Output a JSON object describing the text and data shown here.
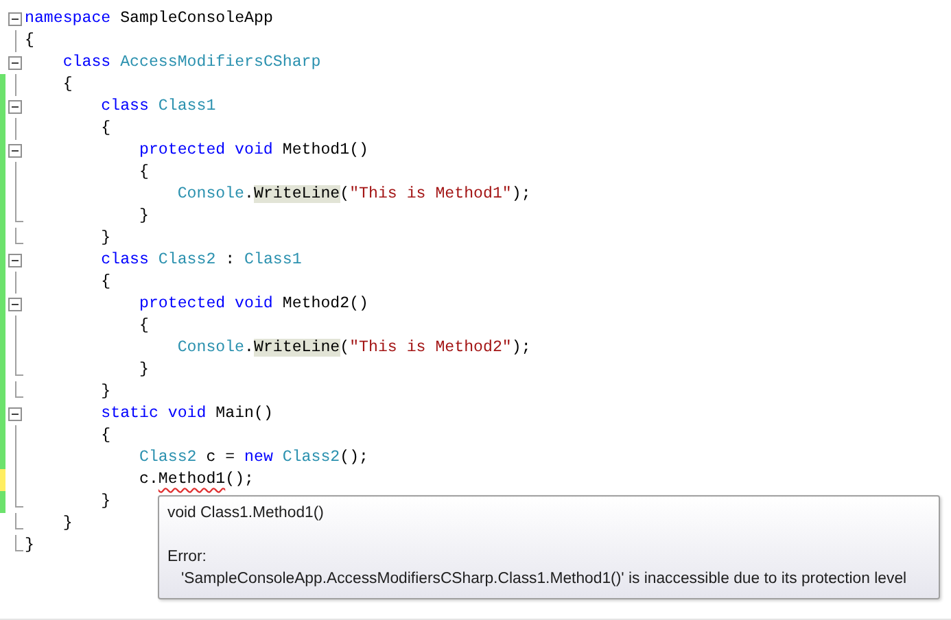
{
  "editor": {
    "lines": [
      {
        "collapsible": true,
        "block_end": false,
        "changed": false,
        "unsaved": false,
        "tokens": [
          {
            "text": "namespace",
            "kind": "keyword"
          },
          {
            "text": " SampleConsoleApp",
            "kind": "plain"
          }
        ]
      },
      {
        "collapsible": false,
        "block_end": false,
        "changed": false,
        "unsaved": false,
        "tokens": [
          {
            "text": "{",
            "kind": "plain"
          }
        ]
      },
      {
        "collapsible": true,
        "block_end": false,
        "changed": false,
        "unsaved": false,
        "tokens": [
          {
            "text": "    class",
            "kind": "keyword"
          },
          {
            "text": " AccessModifiersCSharp",
            "kind": "type"
          }
        ]
      },
      {
        "collapsible": false,
        "block_end": false,
        "changed": true,
        "unsaved": false,
        "tokens": [
          {
            "text": "    {",
            "kind": "plain"
          }
        ]
      },
      {
        "collapsible": true,
        "block_end": false,
        "changed": true,
        "unsaved": false,
        "tokens": [
          {
            "text": "        class",
            "kind": "keyword"
          },
          {
            "text": " Class1",
            "kind": "type"
          }
        ]
      },
      {
        "collapsible": false,
        "block_end": false,
        "changed": true,
        "unsaved": false,
        "tokens": [
          {
            "text": "        {",
            "kind": "plain"
          }
        ]
      },
      {
        "collapsible": true,
        "block_end": false,
        "changed": true,
        "unsaved": false,
        "tokens": [
          {
            "text": "            protected void",
            "kind": "keyword"
          },
          {
            "text": " Method1()",
            "kind": "plain"
          }
        ]
      },
      {
        "collapsible": false,
        "block_end": false,
        "changed": true,
        "unsaved": false,
        "tokens": [
          {
            "text": "            {",
            "kind": "plain"
          }
        ]
      },
      {
        "collapsible": false,
        "block_end": false,
        "changed": true,
        "unsaved": false,
        "tokens": [
          {
            "text": "                Console",
            "kind": "type"
          },
          {
            "text": ".",
            "kind": "plain"
          },
          {
            "text": "WriteLine",
            "kind": "plain",
            "highlighted": true
          },
          {
            "text": "(",
            "kind": "plain"
          },
          {
            "text": "\"This is Method1\"",
            "kind": "string"
          },
          {
            "text": ");",
            "kind": "plain"
          }
        ]
      },
      {
        "collapsible": false,
        "block_end": true,
        "changed": true,
        "unsaved": false,
        "tokens": [
          {
            "text": "            }",
            "kind": "plain"
          }
        ]
      },
      {
        "collapsible": false,
        "block_end": true,
        "changed": true,
        "unsaved": false,
        "tokens": [
          {
            "text": "        }",
            "kind": "plain"
          }
        ]
      },
      {
        "collapsible": true,
        "block_end": false,
        "changed": true,
        "unsaved": false,
        "tokens": [
          {
            "text": "        class",
            "kind": "keyword"
          },
          {
            "text": " Class2",
            "kind": "type"
          },
          {
            "text": " : ",
            "kind": "plain"
          },
          {
            "text": "Class1",
            "kind": "type"
          }
        ]
      },
      {
        "collapsible": false,
        "block_end": false,
        "changed": true,
        "unsaved": false,
        "tokens": [
          {
            "text": "        {",
            "kind": "plain"
          }
        ]
      },
      {
        "collapsible": true,
        "block_end": false,
        "changed": true,
        "unsaved": false,
        "tokens": [
          {
            "text": "            protected void",
            "kind": "keyword"
          },
          {
            "text": " Method2()",
            "kind": "plain"
          }
        ]
      },
      {
        "collapsible": false,
        "block_end": false,
        "changed": true,
        "unsaved": false,
        "tokens": [
          {
            "text": "            {",
            "kind": "plain"
          }
        ]
      },
      {
        "collapsible": false,
        "block_end": false,
        "changed": true,
        "unsaved": false,
        "tokens": [
          {
            "text": "                Console",
            "kind": "type"
          },
          {
            "text": ".",
            "kind": "plain"
          },
          {
            "text": "WriteLine",
            "kind": "plain",
            "highlighted": true
          },
          {
            "text": "(",
            "kind": "plain"
          },
          {
            "text": "\"This is Method2\"",
            "kind": "string"
          },
          {
            "text": ");",
            "kind": "plain"
          }
        ]
      },
      {
        "collapsible": false,
        "block_end": true,
        "changed": true,
        "unsaved": false,
        "tokens": [
          {
            "text": "            }",
            "kind": "plain"
          }
        ]
      },
      {
        "collapsible": false,
        "block_end": true,
        "changed": true,
        "unsaved": false,
        "tokens": [
          {
            "text": "        }",
            "kind": "plain"
          }
        ]
      },
      {
        "collapsible": true,
        "block_end": false,
        "changed": true,
        "unsaved": false,
        "tokens": [
          {
            "text": "        static void",
            "kind": "keyword"
          },
          {
            "text": " Main()",
            "kind": "plain"
          }
        ]
      },
      {
        "collapsible": false,
        "block_end": false,
        "changed": true,
        "unsaved": false,
        "tokens": [
          {
            "text": "        {",
            "kind": "plain"
          }
        ]
      },
      {
        "collapsible": false,
        "block_end": false,
        "changed": true,
        "unsaved": false,
        "tokens": [
          {
            "text": "            Class2",
            "kind": "type"
          },
          {
            "text": " c = ",
            "kind": "plain"
          },
          {
            "text": "new",
            "kind": "keyword"
          },
          {
            "text": " Class2",
            "kind": "type"
          },
          {
            "text": "();",
            "kind": "plain"
          }
        ]
      },
      {
        "collapsible": false,
        "block_end": false,
        "changed": true,
        "unsaved": true,
        "tokens": [
          {
            "text": "            c.",
            "kind": "plain"
          },
          {
            "text": "Method1",
            "kind": "plain",
            "error": true
          },
          {
            "text": "();",
            "kind": "plain"
          }
        ]
      },
      {
        "collapsible": false,
        "block_end": true,
        "changed": true,
        "unsaved": false,
        "tokens": [
          {
            "text": "        }",
            "kind": "plain"
          }
        ]
      },
      {
        "collapsible": false,
        "block_end": true,
        "changed": false,
        "unsaved": false,
        "tokens": [
          {
            "text": "    }",
            "kind": "plain"
          }
        ]
      },
      {
        "collapsible": false,
        "block_end": true,
        "changed": false,
        "unsaved": false,
        "tokens": [
          {
            "text": "}",
            "kind": "plain"
          }
        ]
      }
    ]
  },
  "tooltip": {
    "signature": "void Class1.Method1()",
    "error_label": "Error:",
    "message": "'SampleConsoleApp.AccessModifiersCSharp.Class1.Method1()' is inaccessible due to its protection level"
  }
}
